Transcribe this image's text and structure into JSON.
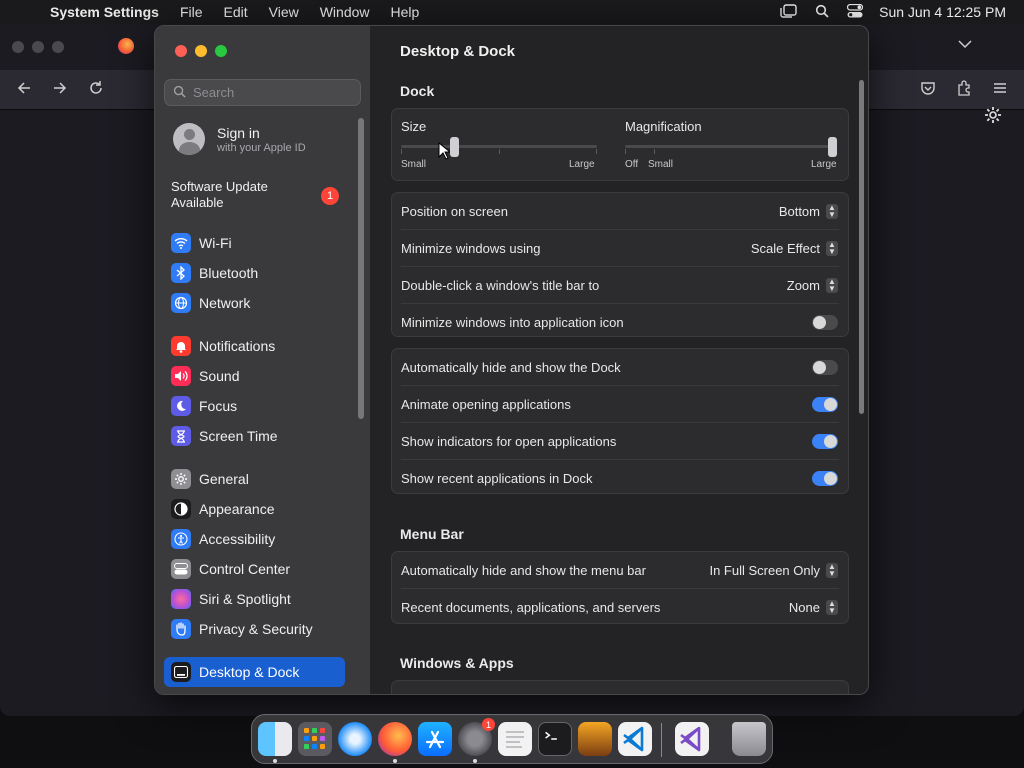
{
  "menubar": {
    "app": "System Settings",
    "items": [
      "File",
      "Edit",
      "View",
      "Window",
      "Help"
    ],
    "datetime": "Sun Jun 4  12:25 PM"
  },
  "window": {
    "search_placeholder": "Search",
    "signin": {
      "title": "Sign in",
      "subtitle": "with your Apple ID"
    },
    "software_update": {
      "label": "Software Update Available",
      "badge": "1"
    },
    "sidebar": [
      {
        "label": "Wi-Fi",
        "icon": "wifi-icon",
        "color": "#2f7cf6"
      },
      {
        "label": "Bluetooth",
        "icon": "bluetooth-icon",
        "color": "#2f7cf6"
      },
      {
        "label": "Network",
        "icon": "globe-icon",
        "color": "#2f7cf6"
      },
      {
        "label": "Notifications",
        "icon": "bell-icon",
        "color": "#ff3b30"
      },
      {
        "label": "Sound",
        "icon": "speaker-icon",
        "color": "#ff2d55"
      },
      {
        "label": "Focus",
        "icon": "moon-icon",
        "color": "#5e5ce6"
      },
      {
        "label": "Screen Time",
        "icon": "hourglass-icon",
        "color": "#5e5ce6"
      },
      {
        "label": "General",
        "icon": "gear-icon",
        "color": "#8e8e93"
      },
      {
        "label": "Appearance",
        "icon": "appearance-icon",
        "color": "#1c1c1e"
      },
      {
        "label": "Accessibility",
        "icon": "accessibility-icon",
        "color": "#2f7cf6"
      },
      {
        "label": "Control Center",
        "icon": "control-center-icon",
        "color": "#8e8e93"
      },
      {
        "label": "Siri & Spotlight",
        "icon": "siri-icon",
        "color": "#b44fd8"
      },
      {
        "label": "Privacy & Security",
        "icon": "hand-icon",
        "color": "#2f7cf6"
      },
      {
        "label": "Desktop & Dock",
        "icon": "dock-icon",
        "color": "#1c1c1e"
      }
    ],
    "title": "Desktop & Dock",
    "dock_section": "Dock",
    "size": {
      "label": "Size",
      "min": "Small",
      "max": "Large",
      "value": 0.27
    },
    "magnification": {
      "label": "Magnification",
      "off": "Off",
      "min": "Small",
      "max": "Large",
      "value": 1.0
    },
    "settings1": [
      {
        "label": "Position on screen",
        "value": "Bottom"
      },
      {
        "label": "Minimize windows using",
        "value": "Scale Effect"
      },
      {
        "label": "Double-click a window's title bar to",
        "value": "Zoom"
      },
      {
        "label": "Minimize windows into application icon",
        "toggle": false
      }
    ],
    "settings2": [
      {
        "label": "Automatically hide and show the Dock",
        "toggle": false
      },
      {
        "label": "Animate opening applications",
        "toggle": true
      },
      {
        "label": "Show indicators for open applications",
        "toggle": true
      },
      {
        "label": "Show recent applications in Dock",
        "toggle": true
      }
    ],
    "menubar_section": "Menu Bar",
    "settings3": [
      {
        "label": "Automatically hide and show the menu bar",
        "value": "In Full Screen Only"
      },
      {
        "label": "Recent documents, applications, and servers",
        "value": "None"
      }
    ],
    "windows_section": "Windows & Apps"
  },
  "dock": {
    "badge": "1",
    "apps": [
      "finder-icon",
      "launchpad-icon",
      "safari-icon",
      "firefox-icon",
      "app-store-icon",
      "system-settings-icon",
      "textedit-icon",
      "terminal-icon",
      "garageband-icon",
      "vscode-icon",
      "visual-studio-icon",
      "trash-icon"
    ]
  }
}
